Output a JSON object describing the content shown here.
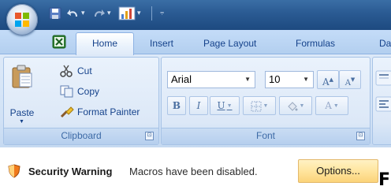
{
  "qat": {
    "icons": [
      "office-button-icon",
      "save-icon",
      "undo-icon",
      "redo-icon",
      "chart-icon",
      "customize-arrow-icon"
    ],
    "undo_arrow": "▾",
    "redo_arrow": "▾",
    "chart_arrow": "▾",
    "customize": "⩦"
  },
  "tabs": {
    "home": "Home",
    "insert": "Insert",
    "page_layout": "Page Layout",
    "formulas": "Formulas",
    "data": "Da"
  },
  "clipboard": {
    "paste": "Paste",
    "cut": "Cut",
    "copy": "Copy",
    "format_painter": "Format Painter",
    "group_label": "Clipboard"
  },
  "font": {
    "name": "Arial",
    "size": "10",
    "grow": "A",
    "shrink": "A",
    "bold": "B",
    "italic": "I",
    "underline": "U",
    "group_label": "Font"
  },
  "launcher_glyph": "⊡",
  "message_bar": {
    "title": "Security Warning",
    "text": "Macros have been disabled.",
    "options_button": "Options...",
    "cursor_glyph": "F"
  },
  "colors": {
    "accent": "#15428b",
    "ribbon": "#d1e2f6",
    "options_button": "#ffe39a"
  }
}
